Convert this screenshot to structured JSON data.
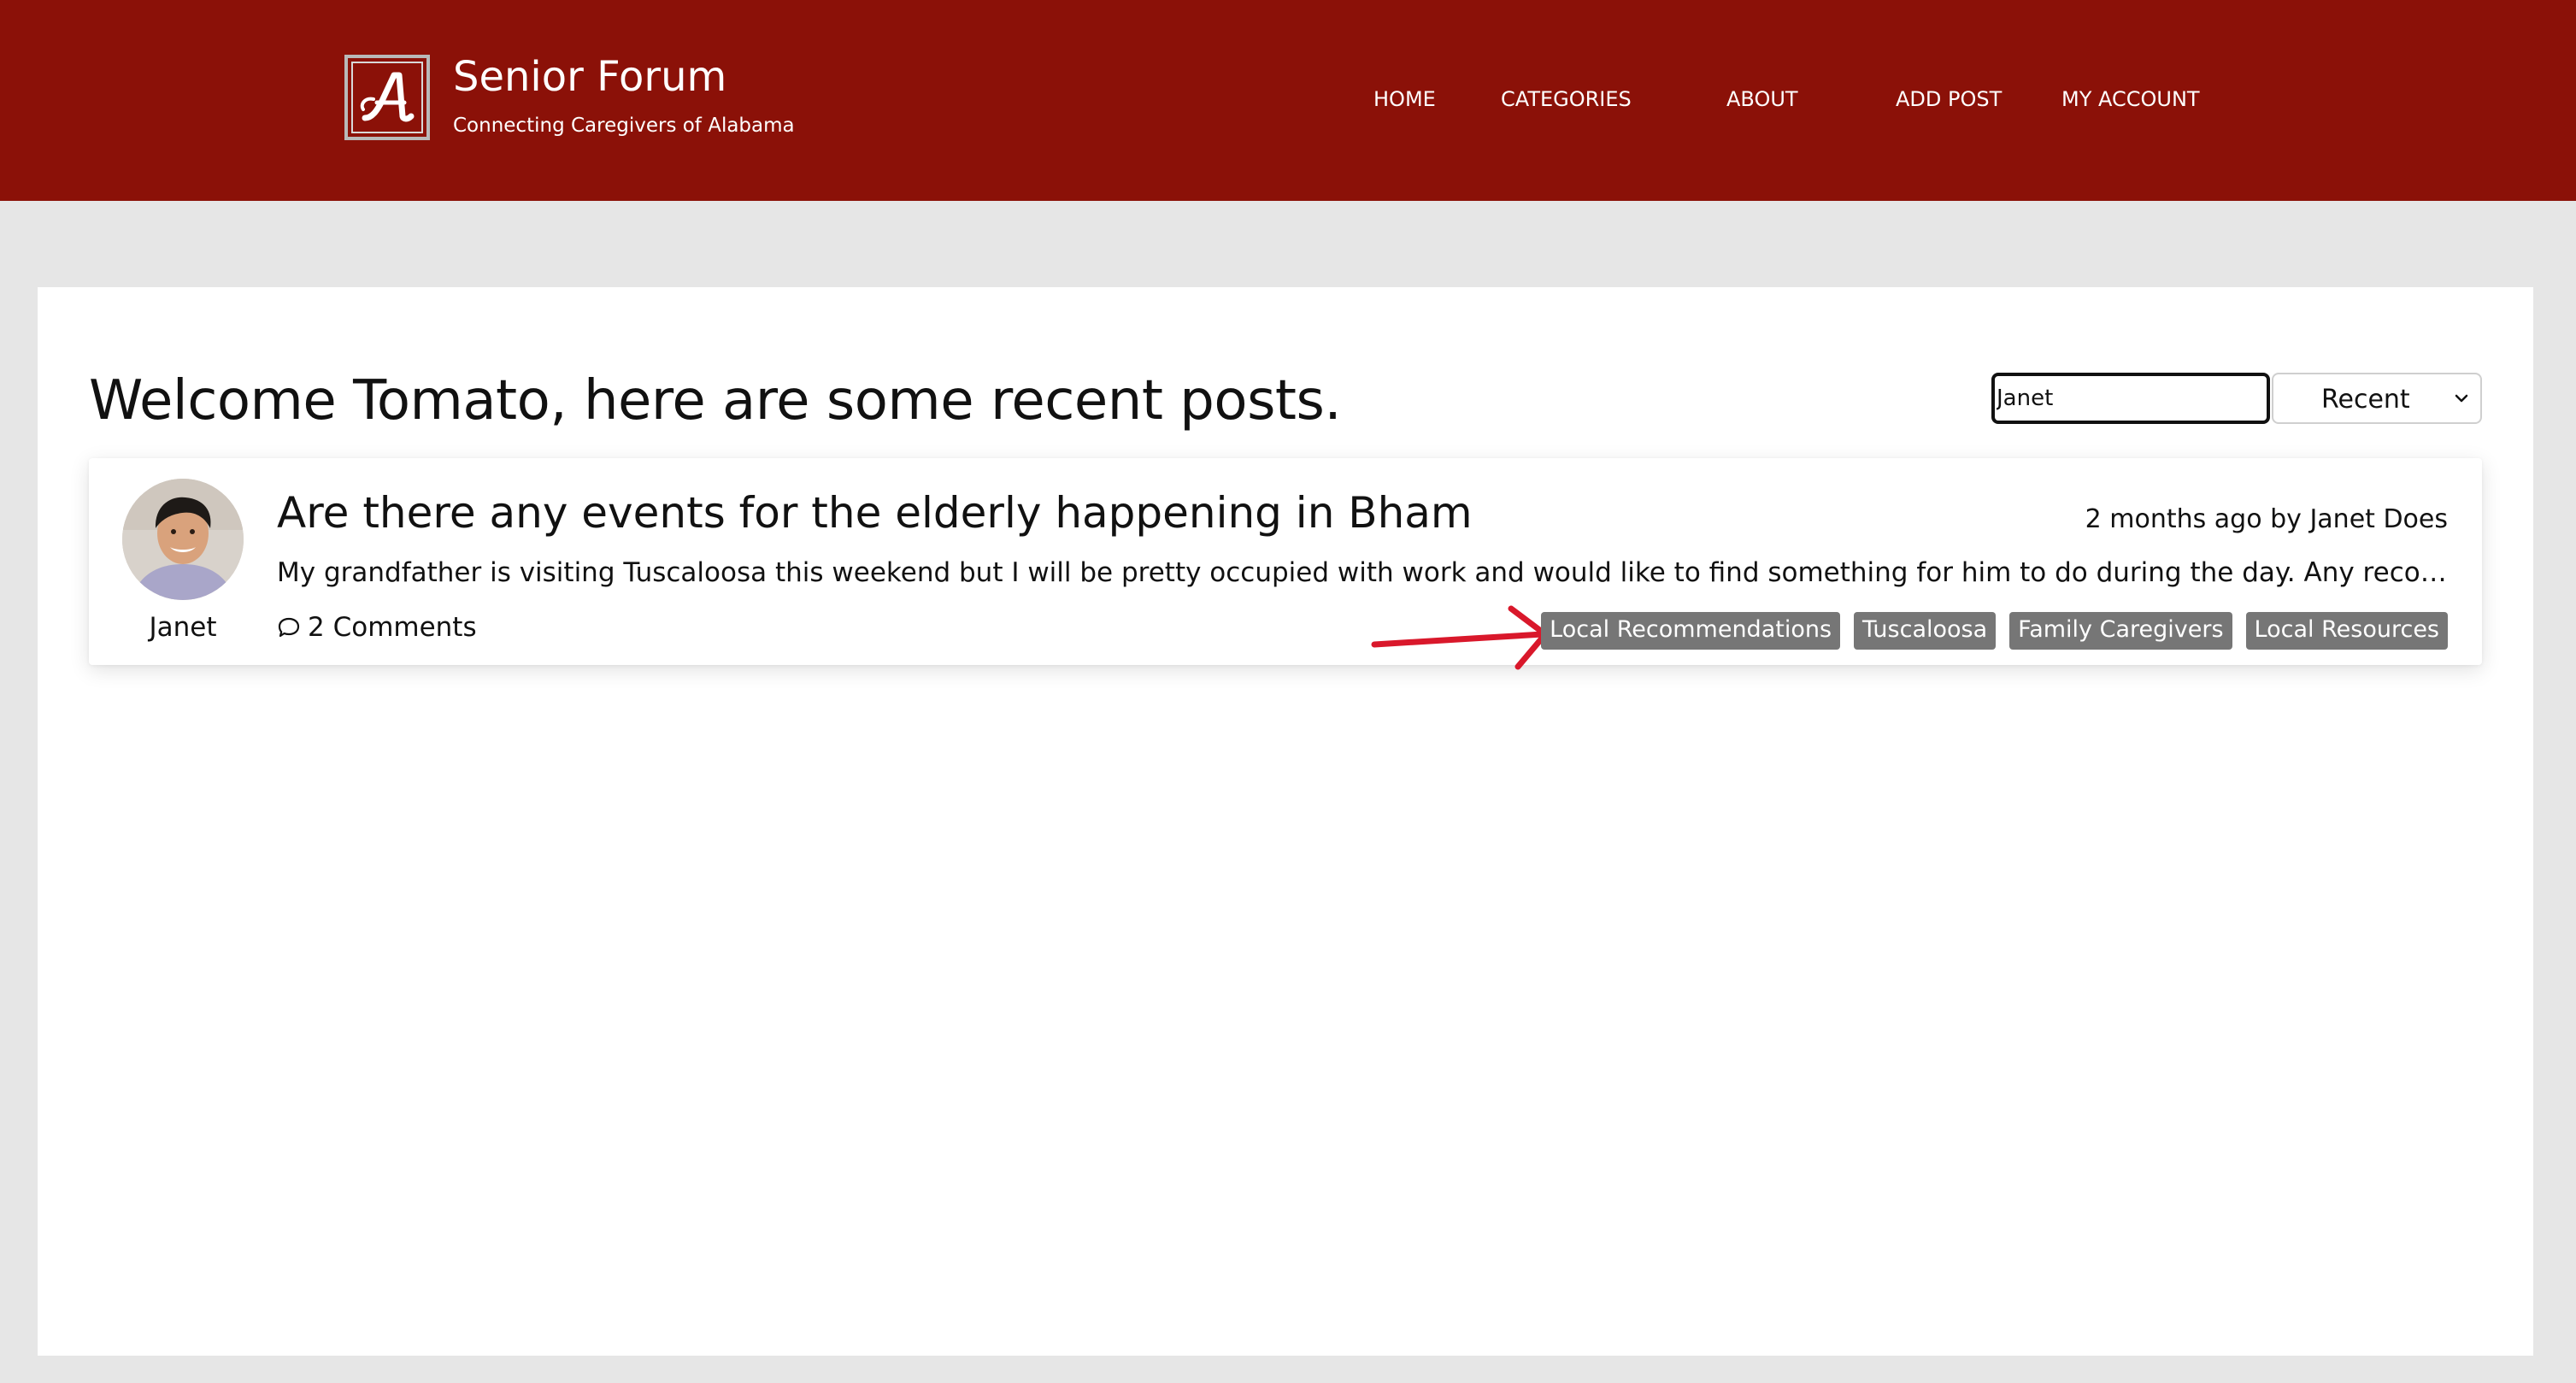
{
  "colors": {
    "header_bg": "#8b1108",
    "page_bg": "#e6e6e6",
    "tag_bg": "#767676",
    "annotation_arrow": "#d9182b"
  },
  "header": {
    "title": "Senior Forum",
    "subtitle": "Connecting Caregivers of Alabama",
    "nav": [
      {
        "label": "HOME"
      },
      {
        "label": "CATEGORIES"
      },
      {
        "label": "ABOUT"
      },
      {
        "label": "ADD POST"
      },
      {
        "label": "MY ACCOUNT"
      }
    ]
  },
  "main": {
    "welcome": "Welcome Tomato, here are some recent posts.",
    "search": {
      "value": "Janet"
    },
    "sort": {
      "selected": "Recent"
    }
  },
  "posts": [
    {
      "author": "Janet",
      "title": "Are there any events for the elderly happening in Bham",
      "meta": "2 months ago by Janet Does",
      "excerpt": "My grandfather is visiting Tuscaloosa this weekend but I will be pretty occupied with work and would like to find something for him to do during the day. Any recommendations",
      "comments": "2 Comments",
      "tags": [
        "Local Recommendations",
        "Tuscaloosa",
        "Family Caregivers",
        "Local Resources"
      ]
    }
  ]
}
